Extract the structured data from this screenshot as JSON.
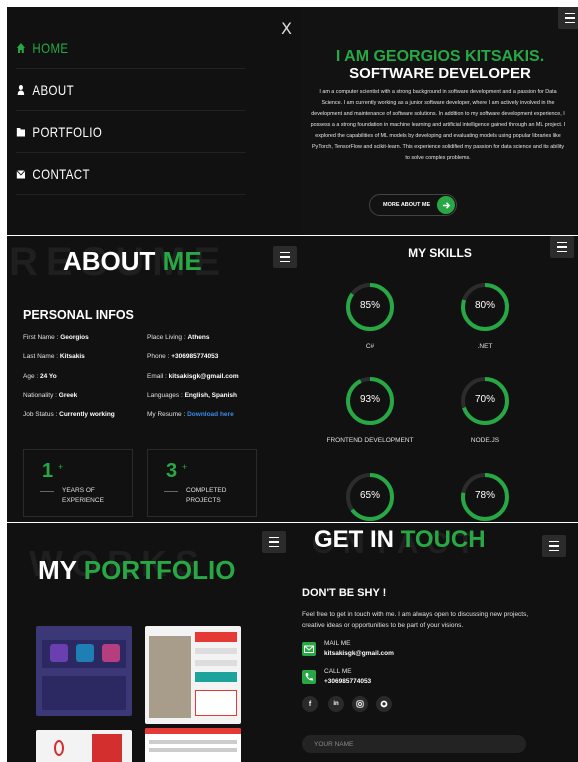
{
  "nav": {
    "close": "X",
    "items": [
      {
        "label": "HOME",
        "icon": "home-icon",
        "active": true
      },
      {
        "label": "ABOUT",
        "icon": "user-icon",
        "active": false
      },
      {
        "label": "PORTFOLIO",
        "icon": "folder-icon",
        "active": false
      },
      {
        "label": "CONTACT",
        "icon": "envelope-icon",
        "active": false
      }
    ]
  },
  "hero": {
    "line1": "I AM GEORGIOS KITSAKIS.",
    "line2": "SOFTWARE DEVELOPER",
    "body": "I am a computer scientist with a strong background in software development and a passion for Data Science. I am currently working as a junior software developer, where I am actively involved in the development and maintenance of software solutions. In addition to my software development experience, I possess a a strong foundation in machine learning and artificial intelligence gained through an ML project. I explored the capabilities of ML models by developing and evaluating models using popular libraries like PyTorch, TensorFlow and scikit-learn. This experience solidified my passion for data science and its ability to solve complex problems.",
    "button": "MORE ABOUT ME"
  },
  "about": {
    "bg_word": "RESUME",
    "title_white": "ABOUT",
    "title_green": "ME",
    "personal_title": "PERSONAL INFOS",
    "left": [
      {
        "label": "First Name : ",
        "value": "Georgios"
      },
      {
        "label": "Last Name : ",
        "value": "Kitsakis"
      },
      {
        "label": "Age : ",
        "value": "24 Yo"
      },
      {
        "label": "Nationality : ",
        "value": "Greek"
      },
      {
        "label": "Job Status : ",
        "value": "Currently working"
      }
    ],
    "right": [
      {
        "label": "Place Living : ",
        "value": "Athens"
      },
      {
        "label": "Phone : ",
        "value": "+306985774053"
      },
      {
        "label": "Email : ",
        "value": "kitsakisgk@gmail.com"
      },
      {
        "label": "Languages : ",
        "value": "English, Spanish"
      },
      {
        "label": "My Resume : ",
        "value": "Download here"
      }
    ],
    "stats": [
      {
        "num": "1",
        "plus": "+",
        "line1": "YEARS OF",
        "line2": "EXPERIENCE"
      },
      {
        "num": "3",
        "plus": "+",
        "line1": "COMPLETED",
        "line2": "PROJECTS"
      }
    ]
  },
  "skills": {
    "title": "MY SKILLS",
    "items": [
      {
        "percent": 85,
        "label": "85%",
        "name": "C#"
      },
      {
        "percent": 80,
        "label": "80%",
        "name": ".NET"
      },
      {
        "percent": 93,
        "label": "93%",
        "name": "FRONTEND DEVELOPMENT"
      },
      {
        "percent": 70,
        "label": "70%",
        "name": "NODE.JS"
      },
      {
        "percent": 65,
        "label": "65%",
        "name": ""
      },
      {
        "percent": 78,
        "label": "78%",
        "name": ""
      }
    ]
  },
  "portfolio": {
    "bg_word": "WORKS",
    "title_white": "MY",
    "title_green": "PORTFOLIO"
  },
  "contact": {
    "bg_word": "CONTACT",
    "title_white": "GET IN",
    "title_green": "TOUCH",
    "heading": "DON'T BE SHY !",
    "body": "Feel free to get in touch with me. I am always open to discussing new projects, creative ideas or opportunities to be part of your visions.",
    "mail_label": "MAIL ME",
    "mail": "kitsakisgk@gmail.com",
    "call_label": "CALL ME",
    "phone": "+306985774053",
    "socials": [
      "f",
      "in",
      "ig",
      "gh"
    ],
    "name_placeholder": "YOUR NAME"
  },
  "colors": {
    "accent": "#27a844",
    "background": "#111111",
    "link": "#3a8be8"
  }
}
